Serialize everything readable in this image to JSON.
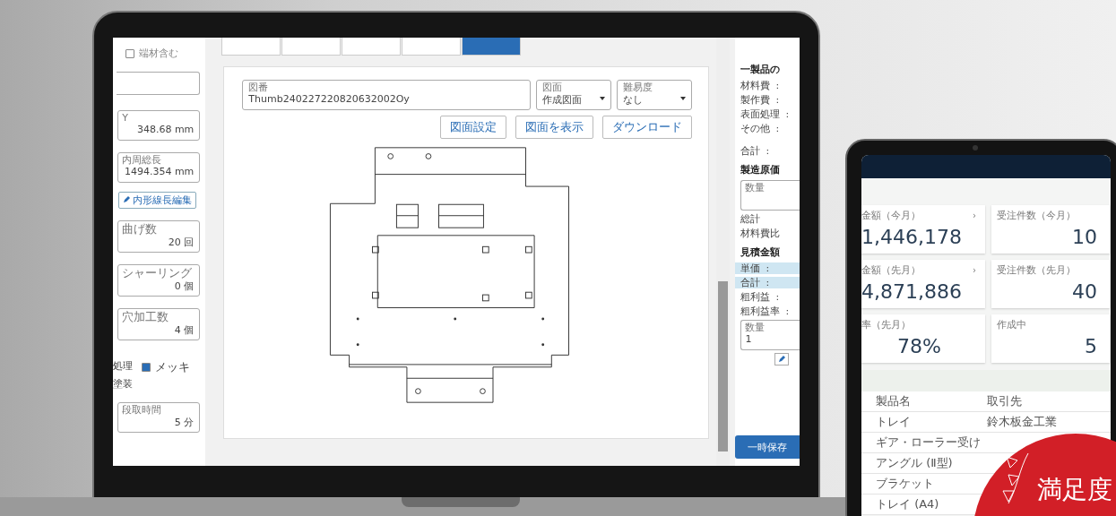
{
  "laptop": {
    "left_panel": {
      "checkbox": {
        "label": "端材含む",
        "checked": false
      },
      "fields": [
        {
          "label": "Y",
          "value": "348.68 mm"
        },
        {
          "label": "内周総長",
          "value": "1494.354 mm"
        },
        {
          "label": "曲げ数",
          "value": "20 回"
        },
        {
          "label": "シャーリング",
          "value": "0 個"
        },
        {
          "label": "穴加工数",
          "value": "4 個"
        }
      ],
      "edit_button": "内形線長編集",
      "options": [
        {
          "kind": "text",
          "label": "処理"
        },
        {
          "kind": "checkbox",
          "label": "メッキ",
          "checked": true
        },
        {
          "kind": "text",
          "label": "塗装"
        }
      ],
      "last_field": {
        "label": "段取時間",
        "value": "5 分"
      }
    },
    "tabs": [
      {
        "selected": false
      },
      {
        "selected": false
      },
      {
        "selected": false
      },
      {
        "selected": false
      },
      {
        "selected": true
      }
    ],
    "drawing_form": {
      "number": {
        "label": "図番",
        "value": "Thumb240227220820632002Oy"
      },
      "selects": [
        {
          "label": "図面",
          "value": "作成図面"
        },
        {
          "label": "難易度",
          "value": "なし"
        }
      ],
      "buttons": [
        "図面設定",
        "図面を表示",
        "ダウンロード"
      ]
    },
    "right_panel": [
      {
        "kind": "heading",
        "label": "一製品の"
      },
      {
        "kind": "row",
        "label": "材料費",
        "separator": ":"
      },
      {
        "kind": "row",
        "label": "製作費",
        "separator": ":"
      },
      {
        "kind": "row",
        "label": "表面処理",
        "separator": ":"
      },
      {
        "kind": "row",
        "label": "その他",
        "separator": ":"
      },
      {
        "kind": "spacer"
      },
      {
        "kind": "row",
        "label": "合計",
        "separator": ":"
      },
      {
        "kind": "heading",
        "label": "製造原価"
      },
      {
        "kind": "field",
        "label": "数量"
      },
      {
        "kind": "plain",
        "label": "総計"
      },
      {
        "kind": "plain",
        "label": "材料費比"
      },
      {
        "kind": "heading",
        "label": "見積金額"
      },
      {
        "kind": "highlight",
        "label": "単価",
        "separator": ":"
      },
      {
        "kind": "highlight",
        "label": "合計",
        "separator": ":"
      },
      {
        "kind": "row",
        "label": "粗利益",
        "separator": ":"
      },
      {
        "kind": "row",
        "label": "粗利益率",
        "separator": ":"
      },
      {
        "kind": "field",
        "label": "数量",
        "value": "1"
      },
      {
        "kind": "edit"
      }
    ],
    "save_button": "一時保存"
  },
  "tablet": {
    "cards": [
      {
        "label": "金額（今月）",
        "value": "1,446,178",
        "arrow": "›"
      },
      {
        "label": "受注件数（今月）",
        "value": "10"
      },
      {
        "label": "金額（先月）",
        "value": "4,871,886",
        "arrow": "›"
      },
      {
        "label": "受注件数（先月）",
        "value": "40"
      },
      {
        "label": "率（先月）",
        "value": "78%"
      },
      {
        "label": "作成中",
        "value": "5"
      }
    ],
    "table": {
      "columns": [
        "製品名",
        "取引先"
      ],
      "rows": [
        [
          "トレイ",
          "鈴木板金工業"
        ],
        [
          "ギア・ローラー受け",
          ""
        ],
        [
          "アングル (Ⅱ型)",
          ""
        ],
        [
          "ブラケット",
          ""
        ],
        [
          "トレイ (A4)",
          ""
        ]
      ]
    }
  },
  "badge": {
    "text": "満足度"
  }
}
